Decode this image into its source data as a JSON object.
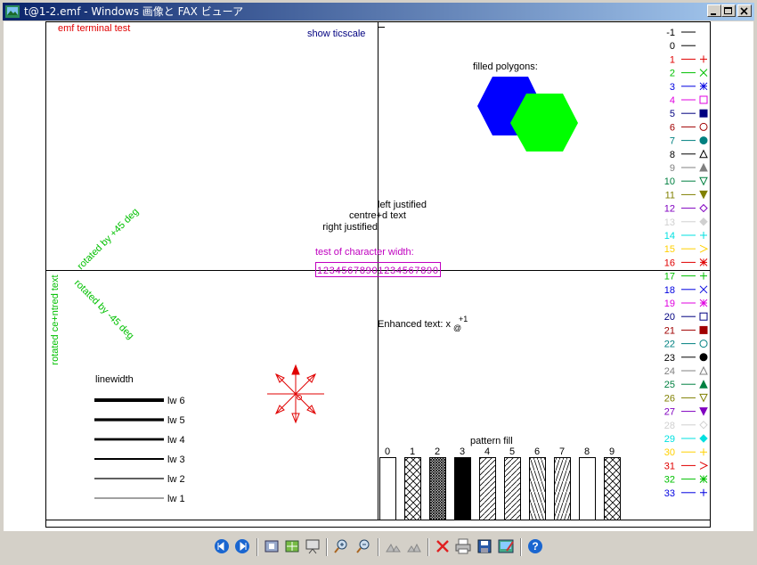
{
  "window": {
    "title": "t@1-2.emf - Windows 画像と FAX ビューア"
  },
  "plot": {
    "terminal_test": "emf  terminal test",
    "show_ticscale": "show ticscale",
    "filled_polygons": "filled polygons:",
    "left_justified": "left justified",
    "centred_text": "centre+d text",
    "right_justified": "right justified",
    "char_width_title": "test of character width:",
    "char_width_sample": "12345678901234567890",
    "enhanced_text": "Enhanced text:  x",
    "enhanced_sub": "@",
    "enhanced_sup": "+1",
    "rotated_centred": "rotated ce+ntred text",
    "rotated_plus45": "rotated by +45 deg",
    "rotated_minus45": "rotated by -45 deg",
    "linewidth_title": "linewidth",
    "linewidths": [
      "lw 6",
      "lw 5",
      "lw 4",
      "lw 3",
      "lw 2",
      "lw 1"
    ],
    "pattern_fill_title": "pattern fill",
    "patterns": [
      "0",
      "1",
      "2",
      "3",
      "4",
      "5",
      "6",
      "7",
      "8",
      "9"
    ],
    "point_types": [
      {
        "label": "-1",
        "color": "#000000"
      },
      {
        "label": "0",
        "color": "#000000"
      },
      {
        "label": "1",
        "color": "#e00000"
      },
      {
        "label": "2",
        "color": "#00c000"
      },
      {
        "label": "3",
        "color": "#0000e0"
      },
      {
        "label": "4",
        "color": "#e000e0"
      },
      {
        "label": "5",
        "color": "#000080"
      },
      {
        "label": "6",
        "color": "#a00000"
      },
      {
        "label": "7",
        "color": "#008080"
      },
      {
        "label": "8",
        "color": "#000000"
      },
      {
        "label": "9",
        "color": "#808080"
      },
      {
        "label": "10",
        "color": "#008040"
      },
      {
        "label": "11",
        "color": "#808000"
      },
      {
        "label": "12",
        "color": "#8000c0"
      },
      {
        "label": "13",
        "color": "#d0d0d0"
      },
      {
        "label": "14",
        "color": "#00e0e0"
      },
      {
        "label": "15",
        "color": "#ffd000"
      },
      {
        "label": "16",
        "color": "#e00000"
      },
      {
        "label": "17",
        "color": "#00c000"
      },
      {
        "label": "18",
        "color": "#0000e0"
      },
      {
        "label": "19",
        "color": "#e000e0"
      },
      {
        "label": "20",
        "color": "#000080"
      },
      {
        "label": "21",
        "color": "#a00000"
      },
      {
        "label": "22",
        "color": "#008080"
      },
      {
        "label": "23",
        "color": "#000000"
      },
      {
        "label": "24",
        "color": "#808080"
      },
      {
        "label": "25",
        "color": "#008040"
      },
      {
        "label": "26",
        "color": "#808000"
      },
      {
        "label": "27",
        "color": "#8000c0"
      },
      {
        "label": "28",
        "color": "#d0d0d0"
      },
      {
        "label": "29",
        "color": "#00e0e0"
      },
      {
        "label": "30",
        "color": "#ffd000"
      },
      {
        "label": "31",
        "color": "#e00000"
      },
      {
        "label": "32",
        "color": "#00c000"
      },
      {
        "label": "33",
        "color": "#0000e0"
      }
    ],
    "colors": {
      "red": "#e00000",
      "green": "#00c000",
      "blue": "#0000e0",
      "magenta": "#c000c0",
      "navy": "#000080",
      "hex_blue": "#0000ff",
      "hex_green": "#00ff00"
    }
  },
  "toolbar": {
    "buttons": [
      {
        "name": "previous-image-button",
        "icon": "prev-icon"
      },
      {
        "name": "next-image-button",
        "icon": "next-icon"
      },
      {
        "name": "best-fit-button",
        "icon": "best-fit-icon"
      },
      {
        "name": "actual-size-button",
        "icon": "actual-size-icon"
      },
      {
        "name": "slideshow-button",
        "icon": "slideshow-icon"
      },
      {
        "name": "zoom-in-button",
        "icon": "zoom-in-icon"
      },
      {
        "name": "zoom-out-button",
        "icon": "zoom-out-icon"
      },
      {
        "name": "rotate-clockwise-button",
        "icon": "rotate-cw-icon"
      },
      {
        "name": "rotate-counterclockwise-button",
        "icon": "rotate-ccw-icon"
      },
      {
        "name": "delete-button",
        "icon": "delete-icon"
      },
      {
        "name": "print-button",
        "icon": "print-icon"
      },
      {
        "name": "save-button",
        "icon": "save-icon"
      },
      {
        "name": "open-editor-button",
        "icon": "edit-icon"
      },
      {
        "name": "help-button",
        "icon": "help-icon"
      }
    ]
  }
}
